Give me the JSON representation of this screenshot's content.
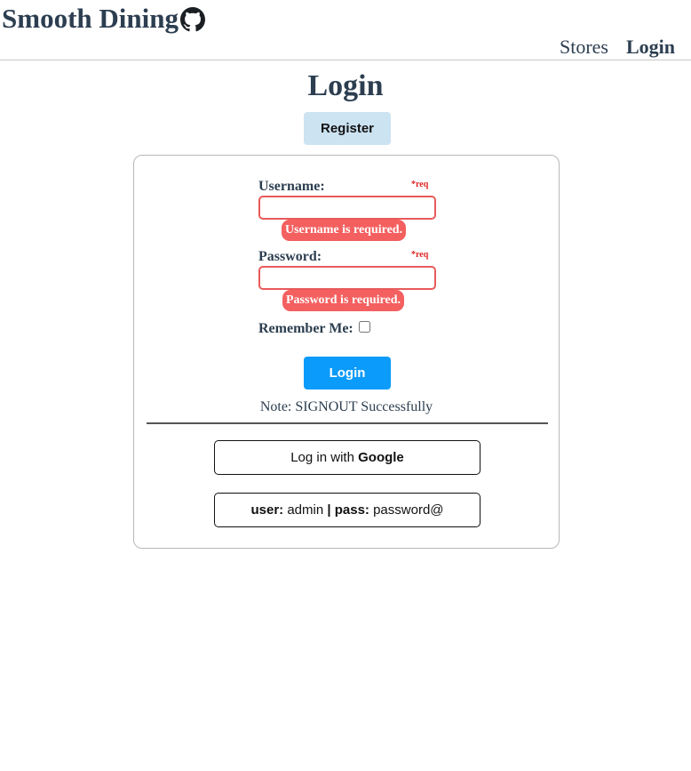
{
  "header": {
    "brand": "Smooth Dining",
    "brand_icon": "github-icon",
    "nav": [
      {
        "label": "Stores",
        "active": false
      },
      {
        "label": "Login",
        "active": true
      }
    ]
  },
  "main": {
    "title": "Login",
    "register_label": "Register"
  },
  "form": {
    "username": {
      "label": "Username:",
      "req": "*req",
      "value": "",
      "error": "Username is required."
    },
    "password": {
      "label": "Password:",
      "req": "*req",
      "value": "",
      "error": "Password is required."
    },
    "remember_label": "Remember Me:",
    "remember_checked": false,
    "login_label": "Login",
    "note": "Note: SIGNOUT Successfully"
  },
  "oauth": {
    "prefix": "Log in with ",
    "provider": "Google"
  },
  "demo": {
    "user_key": "user:",
    "user_value": " admin ",
    "sep": "|",
    "pass_key": " pass:",
    "pass_value": " password@"
  },
  "colors": {
    "text": "#2c3e50",
    "error": "#f45f5f",
    "primary": "#0b9bfa",
    "register_bg": "#cce3f2"
  }
}
